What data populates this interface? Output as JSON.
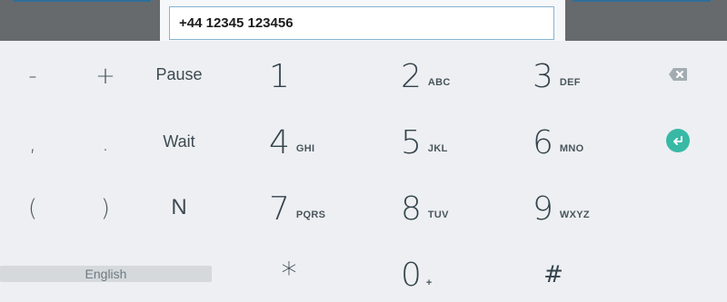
{
  "phone_field": {
    "value": "+44 12345 123456"
  },
  "keys": {
    "minus": "-",
    "plus": "+",
    "pause": "Pause",
    "comma": ",",
    "period": ".",
    "wait": "Wait",
    "paren_open": "(",
    "paren_close": ")",
    "n": "N",
    "star": "*",
    "hash": "#",
    "space_label": "English"
  },
  "numpad": [
    {
      "digit": "1",
      "letters": ""
    },
    {
      "digit": "2",
      "letters": "ABC"
    },
    {
      "digit": "3",
      "letters": "DEF"
    },
    {
      "digit": "4",
      "letters": "GHI"
    },
    {
      "digit": "5",
      "letters": "JKL"
    },
    {
      "digit": "6",
      "letters": "MNO"
    },
    {
      "digit": "7",
      "letters": "PQRS"
    },
    {
      "digit": "8",
      "letters": "TUV"
    },
    {
      "digit": "9",
      "letters": "WXYZ"
    },
    {
      "digit": "0",
      "letters": "+"
    }
  ],
  "icons": {
    "backspace": "backspace-icon",
    "enter": "enter-icon"
  },
  "colors": {
    "keyboard_bg": "#edeff2",
    "enter_accent": "#38b9a5",
    "input_border": "#86b3cf",
    "top_band": "#666a6d"
  }
}
